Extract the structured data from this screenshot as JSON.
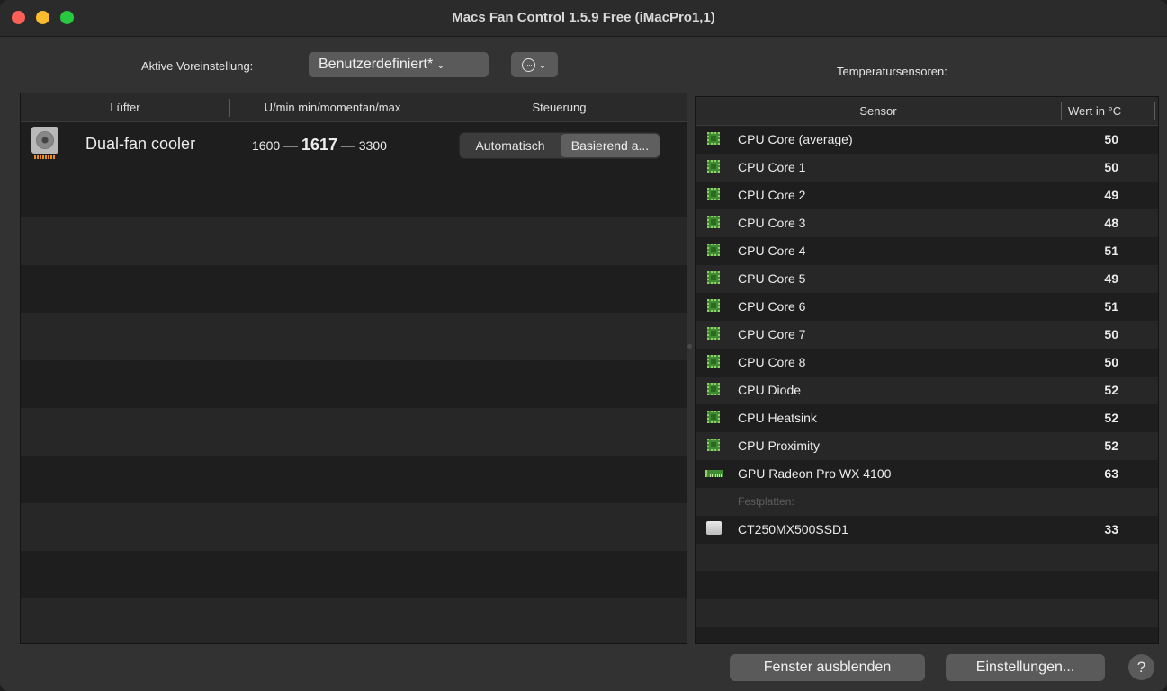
{
  "window": {
    "title": "Macs Fan Control 1.5.9 Free (iMacPro1,1)"
  },
  "toolbar": {
    "preset_label": "Aktive Voreinstellung:",
    "preset_value": "Benutzerdefiniert*",
    "more_icon": "ellipsis-circle-icon",
    "sensors_title": "Temperatursensoren:"
  },
  "fans": {
    "columns": [
      "Lüfter",
      "U/min min/momentan/max",
      "Steuerung"
    ],
    "rows": [
      {
        "name": "Dual-fan cooler",
        "icon": "fan-icon",
        "rpm_min": "1600",
        "rpm_current": "1617",
        "rpm_max": "3300",
        "separator": "—",
        "control_options": [
          "Automatisch",
          "Basierend a..."
        ],
        "control_selected": "Basierend a..."
      }
    ]
  },
  "sensors": {
    "columns": [
      "Sensor",
      "Wert in °C"
    ],
    "rows": [
      {
        "name": "CPU Core (average)",
        "value": "50",
        "icon": "cpu-chip-icon"
      },
      {
        "name": "CPU Core 1",
        "value": "50",
        "icon": "cpu-chip-icon"
      },
      {
        "name": "CPU Core 2",
        "value": "49",
        "icon": "cpu-chip-icon"
      },
      {
        "name": "CPU Core 3",
        "value": "48",
        "icon": "cpu-chip-icon"
      },
      {
        "name": "CPU Core 4",
        "value": "51",
        "icon": "cpu-chip-icon"
      },
      {
        "name": "CPU Core 5",
        "value": "49",
        "icon": "cpu-chip-icon"
      },
      {
        "name": "CPU Core 6",
        "value": "51",
        "icon": "cpu-chip-icon"
      },
      {
        "name": "CPU Core 7",
        "value": "50",
        "icon": "cpu-chip-icon"
      },
      {
        "name": "CPU Core 8",
        "value": "50",
        "icon": "cpu-chip-icon"
      },
      {
        "name": "CPU Diode",
        "value": "52",
        "icon": "cpu-chip-icon"
      },
      {
        "name": "CPU Heatsink",
        "value": "52",
        "icon": "cpu-chip-icon"
      },
      {
        "name": "CPU Proximity",
        "value": "52",
        "icon": "cpu-chip-icon"
      },
      {
        "name": "GPU Radeon Pro WX 4100",
        "value": "63",
        "icon": "gpu-card-icon"
      }
    ],
    "group_label": "Festplatten:",
    "disks": [
      {
        "name": "CT250MX500SSD1",
        "value": "33",
        "icon": "disk-icon"
      }
    ]
  },
  "footer": {
    "hide_label": "Fenster ausblenden",
    "settings_label": "Einstellungen...",
    "help_label": "?"
  }
}
